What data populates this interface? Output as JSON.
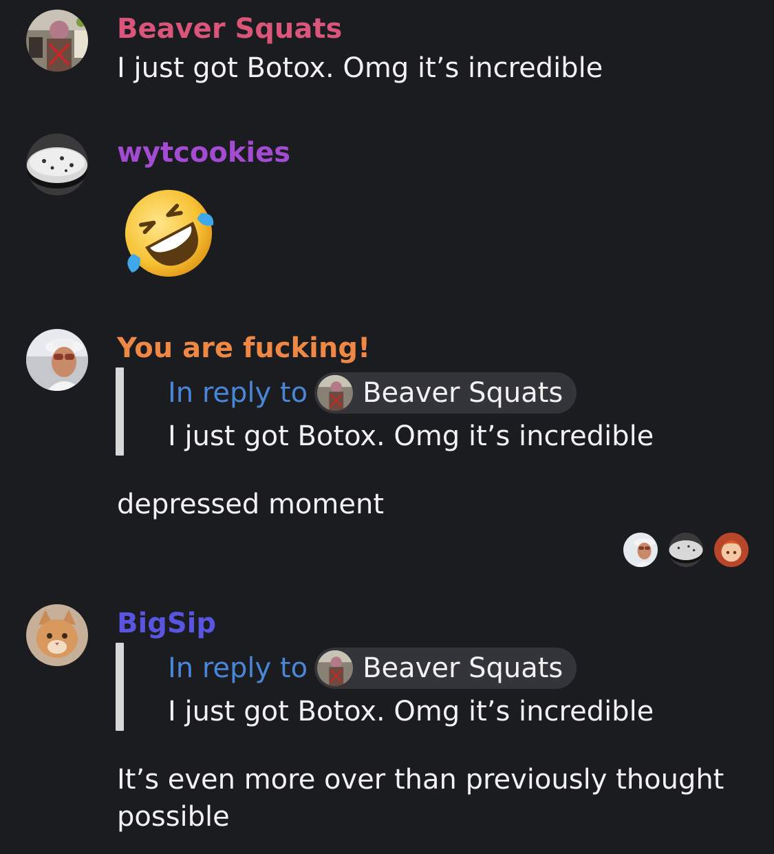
{
  "messages": [
    {
      "username": "Beaver Squats",
      "username_color": "#d9557a",
      "text": "I just got Botox. Omg it’s incredible"
    },
    {
      "username": "wytcookies",
      "username_color": "#a34bd1",
      "emoji": "rolling-on-the-floor-laughing"
    },
    {
      "username": "You are fucking!",
      "username_color": "#ee8844",
      "reply": {
        "prefix": "In reply to",
        "author": "Beaver Squats",
        "quote": "I just got Botox. Omg it’s incredible"
      },
      "text": "depressed moment",
      "reaction_avatars": [
        "sunglasses-man-avatar",
        "cookie-avatar",
        "anime-girl-avatar"
      ]
    },
    {
      "username": "BigSip",
      "username_color": "#5a55e0",
      "reply": {
        "prefix": "In reply to",
        "author": "Beaver Squats",
        "quote": "I just got Botox. Omg it’s incredible"
      },
      "text": "It’s even more over than previously thought possible"
    }
  ],
  "colors": {
    "background": "#1b1c20",
    "reply_link": "#4a86d8",
    "reply_chip": "#34353a",
    "reply_bar": "#d8d8d8"
  }
}
